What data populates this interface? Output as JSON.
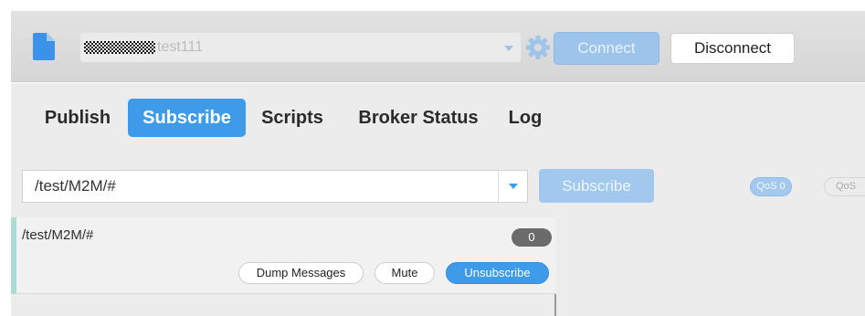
{
  "connection": {
    "profile_name": "test111",
    "connect_label": "Connect",
    "disconnect_label": "Disconnect",
    "file_icon": "file-icon",
    "settings_icon": "gear-icon"
  },
  "tabs": [
    {
      "label": "Publish",
      "active": false
    },
    {
      "label": "Subscribe",
      "active": true
    },
    {
      "label": "Scripts",
      "active": false
    },
    {
      "label": "Broker Status",
      "active": false
    },
    {
      "label": "Log",
      "active": false
    }
  ],
  "subscribe_bar": {
    "topic_value": "/test/M2M/#",
    "subscribe_label": "Subscribe",
    "qos_options": [
      "QoS 0",
      "QoS"
    ]
  },
  "subscriptions": [
    {
      "topic": "/test/M2M/#",
      "message_count": "0",
      "actions": {
        "dump": "Dump Messages",
        "mute": "Mute",
        "unsubscribe": "Unsubscribe"
      }
    }
  ],
  "colors": {
    "accent": "#3d9be9",
    "accent_disabled": "#a2c9ed",
    "subscription_marker": "#a8dcd4"
  }
}
